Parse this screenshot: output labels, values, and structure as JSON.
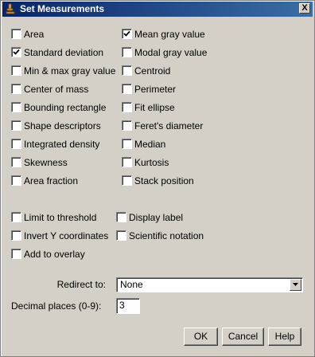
{
  "window": {
    "title": "Set Measurements",
    "close_glyph": "X",
    "icon": "microscope-icon"
  },
  "measurements": [
    {
      "label": "Area",
      "checked": false
    },
    {
      "label": "Mean gray value",
      "checked": true
    },
    {
      "label": "Standard deviation",
      "checked": true
    },
    {
      "label": "Modal gray value",
      "checked": false
    },
    {
      "label": "Min & max gray value",
      "checked": false
    },
    {
      "label": "Centroid",
      "checked": false
    },
    {
      "label": "Center of mass",
      "checked": false
    },
    {
      "label": "Perimeter",
      "checked": false
    },
    {
      "label": "Bounding rectangle",
      "checked": false
    },
    {
      "label": "Fit ellipse",
      "checked": false
    },
    {
      "label": "Shape descriptors",
      "checked": false
    },
    {
      "label": "Feret's diameter",
      "checked": false
    },
    {
      "label": "Integrated density",
      "checked": false
    },
    {
      "label": "Median",
      "checked": false
    },
    {
      "label": "Skewness",
      "checked": false
    },
    {
      "label": "Kurtosis",
      "checked": false
    },
    {
      "label": "Area fraction",
      "checked": false
    },
    {
      "label": "Stack position",
      "checked": false
    }
  ],
  "options": [
    {
      "label": "Limit to threshold",
      "checked": false
    },
    {
      "label": "Display label",
      "checked": false
    },
    {
      "label": "Invert Y coordinates",
      "checked": false
    },
    {
      "label": "Scientific notation",
      "checked": false
    },
    {
      "label": "Add to overlay",
      "checked": false
    }
  ],
  "redirect": {
    "label": "Redirect to:",
    "value": "None"
  },
  "decimal": {
    "label": "Decimal places (0-9):",
    "value": "3"
  },
  "buttons": {
    "ok": "OK",
    "cancel": "Cancel",
    "help": "Help"
  }
}
